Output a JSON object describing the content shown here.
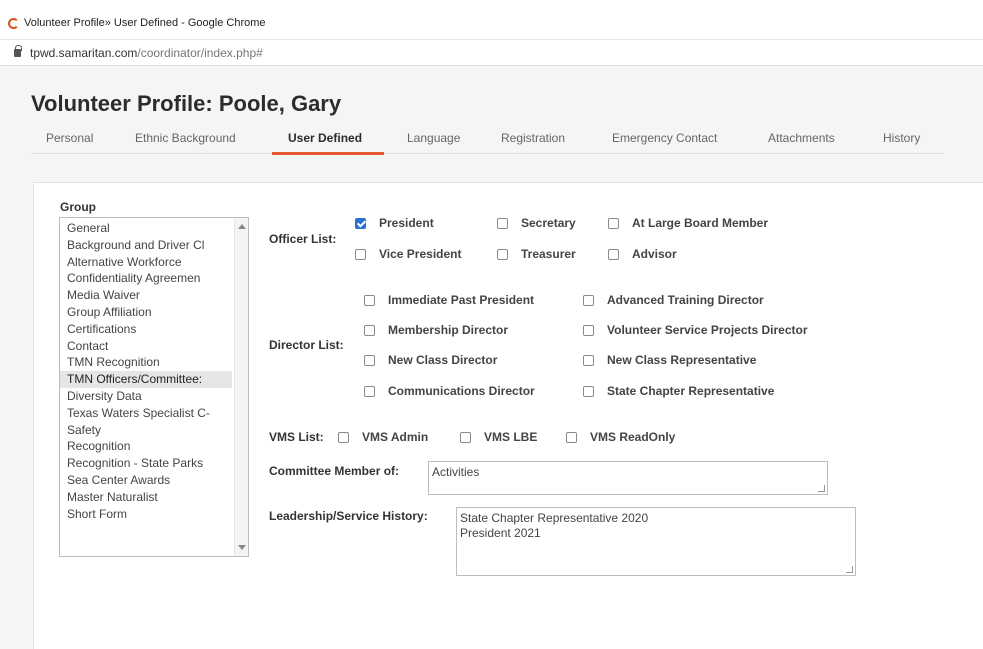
{
  "browser": {
    "window_title": "Volunteer Profile» User Defined - Google Chrome",
    "url_host": "tpwd.samaritan.com",
    "url_path": "/coordinator/index.php#"
  },
  "page": {
    "title": "Volunteer Profile: Poole, Gary"
  },
  "tabs": [
    {
      "label": "Personal"
    },
    {
      "label": "Ethnic Background"
    },
    {
      "label": "User Defined",
      "active": true
    },
    {
      "label": "Language"
    },
    {
      "label": "Registration"
    },
    {
      "label": "Emergency Contact"
    },
    {
      "label": "Attachments"
    },
    {
      "label": "History"
    }
  ],
  "group": {
    "label": "Group",
    "items": [
      "General",
      "Background and Driver Cl",
      "Alternative Workforce",
      "Confidentiality Agreemen",
      "Media Waiver",
      "Group Affiliation",
      "Certifications",
      "Contact",
      "TMN Recognition",
      "TMN Officers/Committee:",
      "Diversity Data",
      "Texas Waters Specialist C-",
      "Safety",
      "Recognition",
      "Recognition - State Parks",
      "Sea Center Awards",
      "Master Naturalist",
      "Short Form"
    ],
    "selected": "TMN Officers/Committee:"
  },
  "officer_list": {
    "label": "Officer List:",
    "options": [
      {
        "label": "President",
        "checked": true
      },
      {
        "label": "Secretary",
        "checked": false
      },
      {
        "label": "At Large Board Member",
        "checked": false
      },
      {
        "label": "Vice President",
        "checked": false
      },
      {
        "label": "Treasurer",
        "checked": false
      },
      {
        "label": "Advisor",
        "checked": false
      }
    ]
  },
  "director_list": {
    "label": "Director List:",
    "options": [
      {
        "label": "Immediate Past President",
        "checked": false
      },
      {
        "label": "Advanced Training Director",
        "checked": false
      },
      {
        "label": "Membership Director",
        "checked": false
      },
      {
        "label": "Volunteer Service Projects Director",
        "checked": false
      },
      {
        "label": "New Class Director",
        "checked": false
      },
      {
        "label": "New Class Representative",
        "checked": false
      },
      {
        "label": "Communications Director",
        "checked": false
      },
      {
        "label": "State Chapter Representative",
        "checked": false
      }
    ]
  },
  "vms_list": {
    "label": "VMS List:",
    "options": [
      {
        "label": "VMS Admin",
        "checked": false
      },
      {
        "label": "VMS LBE",
        "checked": false
      },
      {
        "label": "VMS ReadOnly",
        "checked": false
      }
    ]
  },
  "committee": {
    "label": "Committee Member of:",
    "value": "Activities"
  },
  "leadership": {
    "label": "Leadership/Service History:",
    "lines": [
      "State Chapter Representative 2020",
      "President 2021"
    ]
  }
}
